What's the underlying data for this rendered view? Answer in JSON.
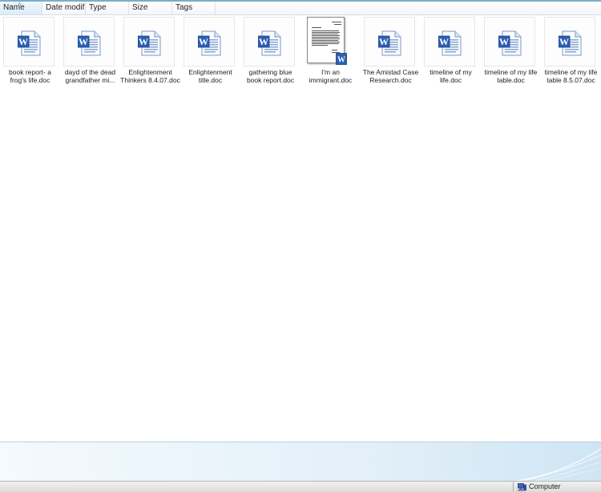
{
  "header": {
    "columns": [
      {
        "label": "Name"
      },
      {
        "label": "Date modif..."
      },
      {
        "label": "Type"
      },
      {
        "label": "Size"
      },
      {
        "label": "Tags"
      }
    ]
  },
  "files": [
    {
      "line1": "book report- a",
      "line2": "frog's life.doc",
      "icon": "word-doc-icon"
    },
    {
      "line1": "dayd of the dead",
      "line2": "grandfather mi...",
      "icon": "word-doc-icon"
    },
    {
      "line1": "Enlightenment",
      "line2": "Thinkers 8.4.07.doc",
      "icon": "word-doc-icon"
    },
    {
      "line1": "Enlightenment",
      "line2": "title.doc",
      "icon": "word-doc-icon"
    },
    {
      "line1": "gathering blue",
      "line2": "book report.doc",
      "icon": "word-doc-icon"
    },
    {
      "line1": "I'm an",
      "line2": "immigrant.doc",
      "icon": "document-preview-thumbnail"
    },
    {
      "line1": "The Amistad Case",
      "line2": "Research.doc",
      "icon": "word-doc-icon"
    },
    {
      "line1": "timeline of my",
      "line2": "life.doc",
      "icon": "word-doc-icon"
    },
    {
      "line1": "timeline of my life",
      "line2": "table.doc",
      "icon": "word-doc-icon"
    },
    {
      "line1": "timeline of my life",
      "line2": "table 8.5.07.doc",
      "icon": "word-doc-icon"
    }
  ],
  "status": {
    "location": "Computer",
    "icon": "computer-icon"
  },
  "colors": {
    "accent": "#7aaec4",
    "word_blue": "#2b5fb4",
    "details_pane": "#e3f0f9"
  }
}
